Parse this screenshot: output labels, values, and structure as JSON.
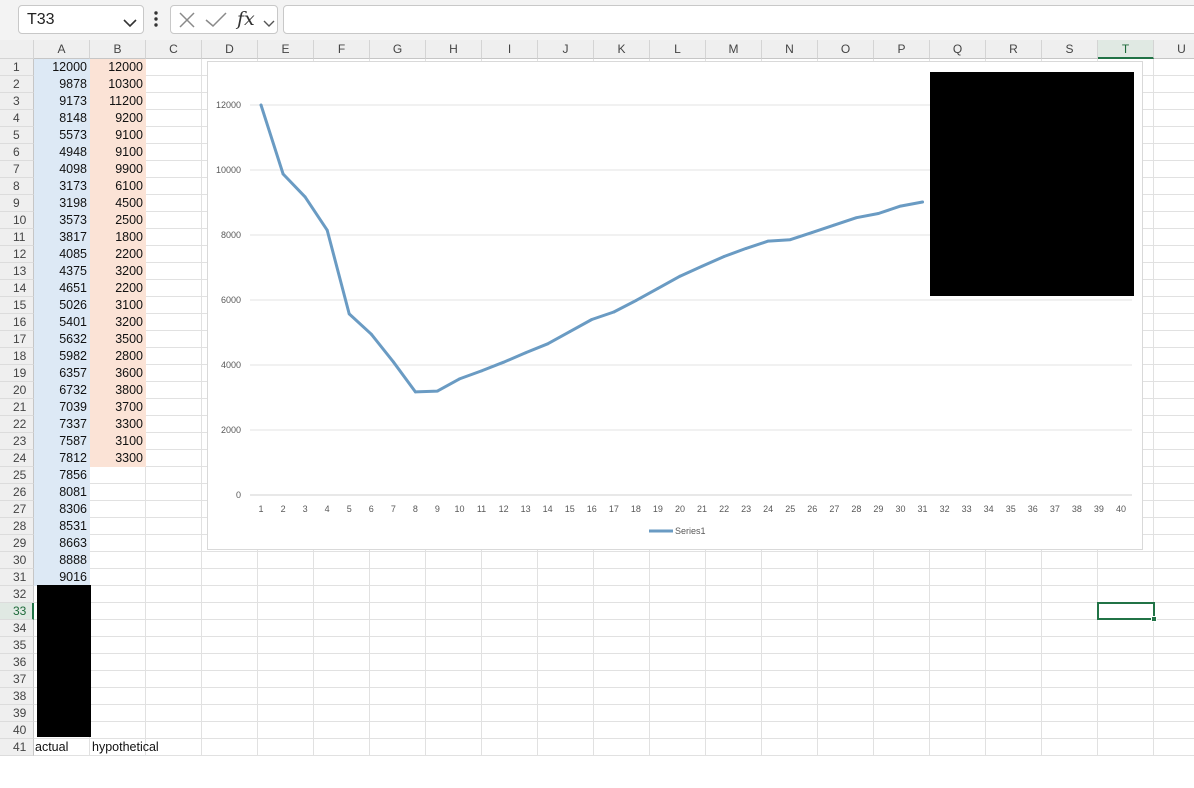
{
  "formula_bar": {
    "name_box": "T33",
    "formula": ""
  },
  "icons": {
    "name_box_dropdown": "chevron-down-icon",
    "more": "vertical-dots-icon",
    "cancel": "close-icon",
    "enter": "check-icon",
    "insert_function": "fx-icon"
  },
  "columns": [
    "A",
    "B",
    "C",
    "D",
    "E",
    "F",
    "G",
    "H",
    "I",
    "J",
    "K",
    "L",
    "M",
    "N",
    "O",
    "P",
    "Q",
    "R",
    "S",
    "T",
    "U"
  ],
  "selected_column": "T",
  "selected_row": 33,
  "rows": [
    1,
    2,
    3,
    4,
    5,
    6,
    7,
    8,
    9,
    10,
    11,
    12,
    13,
    14,
    15,
    16,
    17,
    18,
    19,
    20,
    21,
    22,
    23,
    24,
    25,
    26,
    27,
    28,
    29,
    30,
    31,
    32,
    33,
    34,
    35,
    36,
    37,
    38,
    39,
    40,
    41
  ],
  "sheet": {
    "col_a": [
      12000,
      9878,
      9173,
      8148,
      5573,
      4948,
      4098,
      3173,
      3198,
      3573,
      3817,
      4085,
      4375,
      4651,
      5026,
      5401,
      5632,
      5982,
      6357,
      6732,
      7039,
      7337,
      7587,
      7812,
      7856,
      8081,
      8306,
      8531,
      8663,
      8888,
      9016
    ],
    "col_b": [
      12000,
      10300,
      11200,
      9200,
      9100,
      9100,
      9900,
      6100,
      4500,
      2500,
      1800,
      2200,
      3200,
      2200,
      3100,
      3200,
      3500,
      2800,
      3600,
      3800,
      3700,
      3300,
      3100,
      3300
    ],
    "a41": "actual",
    "b41": "hypothetical"
  },
  "colors": {
    "accent": "#217346",
    "col_a_fill": "#dde9f5",
    "col_b_fill": "#fbe3d6",
    "series": "#6a9bc3"
  },
  "chart_data": {
    "type": "line",
    "title": "",
    "xlabel": "",
    "ylabel": "",
    "x": [
      1,
      2,
      3,
      4,
      5,
      6,
      7,
      8,
      9,
      10,
      11,
      12,
      13,
      14,
      15,
      16,
      17,
      18,
      19,
      20,
      21,
      22,
      23,
      24,
      25,
      26,
      27,
      28,
      29,
      30,
      31,
      32,
      33,
      34,
      35,
      36,
      37,
      38,
      39,
      40
    ],
    "y_ticks": [
      0,
      2000,
      4000,
      6000,
      8000,
      10000,
      12000
    ],
    "ylim": [
      0,
      12000
    ],
    "grid": true,
    "legend_position": "bottom",
    "series": [
      {
        "name": "Series1",
        "values": [
          12000,
          9878,
          9173,
          8148,
          5573,
          4948,
          4098,
          3173,
          3198,
          3573,
          3817,
          4085,
          4375,
          4651,
          5026,
          5401,
          5632,
          5982,
          6357,
          6732,
          7039,
          7337,
          7587,
          7812,
          7856,
          8081,
          8306,
          8531,
          8663,
          8888,
          9016
        ]
      }
    ]
  }
}
